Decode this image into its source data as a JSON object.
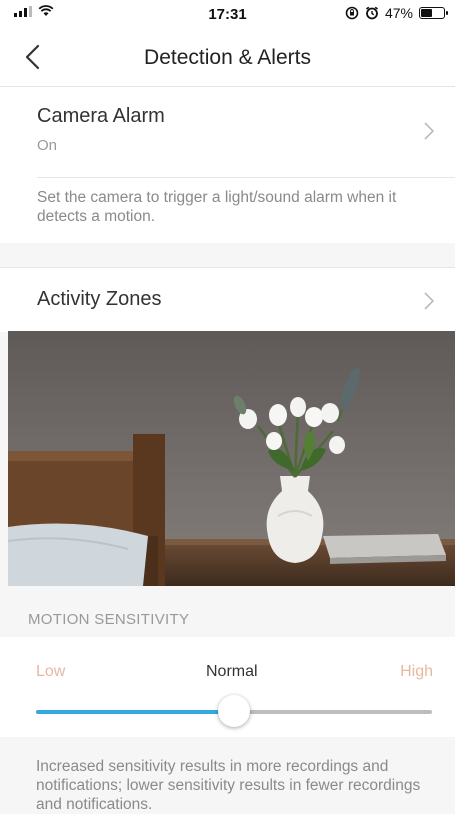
{
  "status_bar": {
    "time": "17:31",
    "battery": "47%"
  },
  "nav": {
    "title": "Detection & Alerts"
  },
  "camera_alarm": {
    "title": "Camera Alarm",
    "value": "On",
    "description": "Set the camera to trigger a light/sound alarm when it detects a motion."
  },
  "activity_zones": {
    "title": "Activity Zones"
  },
  "motion_sensitivity": {
    "section_label": "MOTION SENSITIVITY",
    "low_label": "Low",
    "current_label": "Normal",
    "high_label": "High",
    "level": 0.5,
    "description": "Increased sensitivity results in more recordings and notifications; lower sensitivity results in fewer recordings and notifications."
  },
  "colors": {
    "accent": "#35a8e0",
    "endpoint_labels": "#e6b9a2"
  }
}
